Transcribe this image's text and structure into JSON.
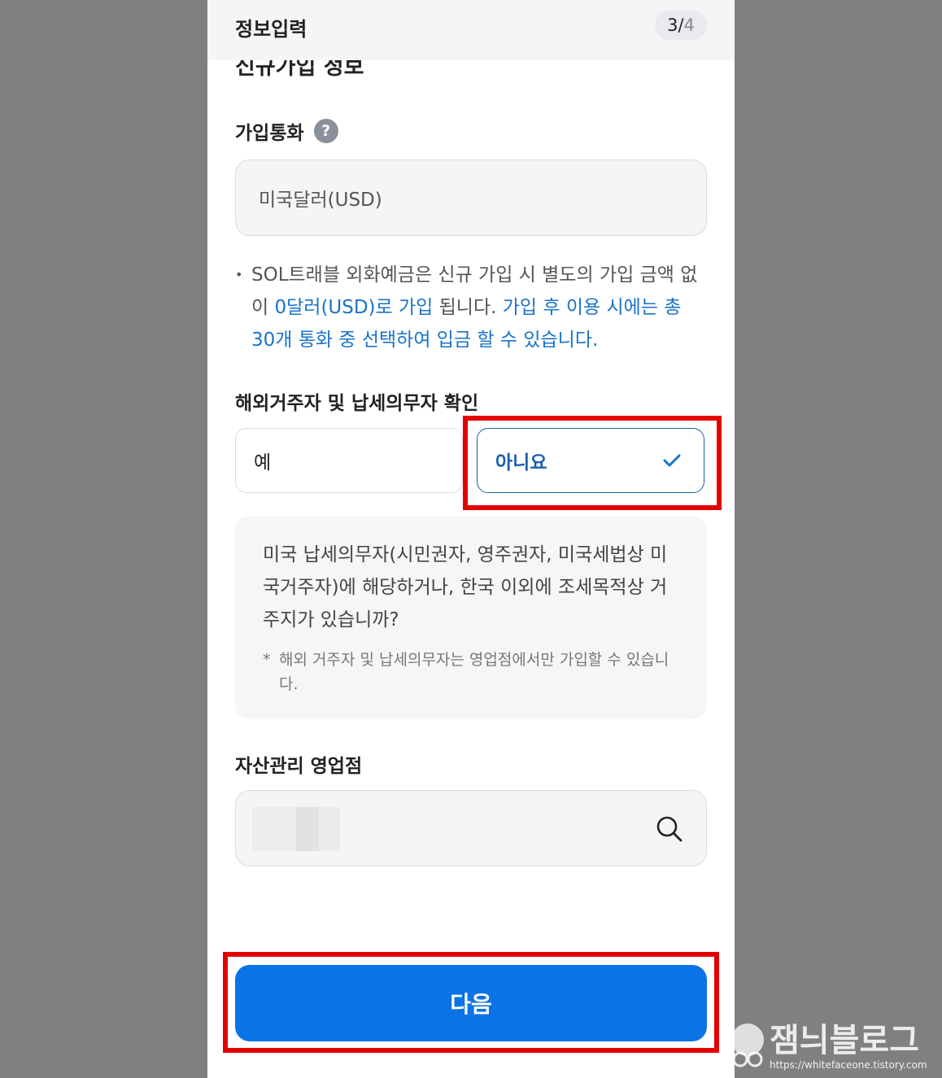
{
  "header": {
    "title": "정보입력",
    "step_current": "3",
    "step_sep": "/",
    "step_total": "4"
  },
  "section_title_partial": "신규가입 정보",
  "currency": {
    "label": "가입통화",
    "help_symbol": "?",
    "value": "미국달러(USD)"
  },
  "notice": {
    "bullet": "•",
    "part1": "SOL트래블 외화예금은 신규 가입 시 별도의 가입 금액 없이 ",
    "part2_highlight": "0달러(USD)로 가입",
    "part3": " 됩니다. ",
    "part4_highlight": "가입 후 이용 시에는 총 30개 통화 중 선택하여 입금 할 수 있습니다."
  },
  "residency": {
    "label": "해외거주자 및 납세의무자 확인",
    "option_yes": "예",
    "option_no": "아니요",
    "selected": "아니요",
    "info_main": "미국 납세의무자(시민권자, 영주권자, 미국세법상 미국거주자)에 해당하거나, 한국 이외에 조세목적상 거주지가 있습니까?",
    "info_note_mark": "*",
    "info_note": "해외 거주자 및 납세의무자는 영업점에서만 가입할 수 있습니다."
  },
  "branch": {
    "label": "자산관리 영업점"
  },
  "next_button": "다음",
  "watermark": {
    "title": "잼늬블로그",
    "url": "https://whitefaceone.tistory.com"
  },
  "colors": {
    "accent_blue": "#0a73e6",
    "link_blue": "#1a73c8",
    "highlight_red": "#e30000",
    "backdrop": "#808080"
  },
  "icons": [
    "help-icon",
    "check-icon",
    "search-icon"
  ]
}
